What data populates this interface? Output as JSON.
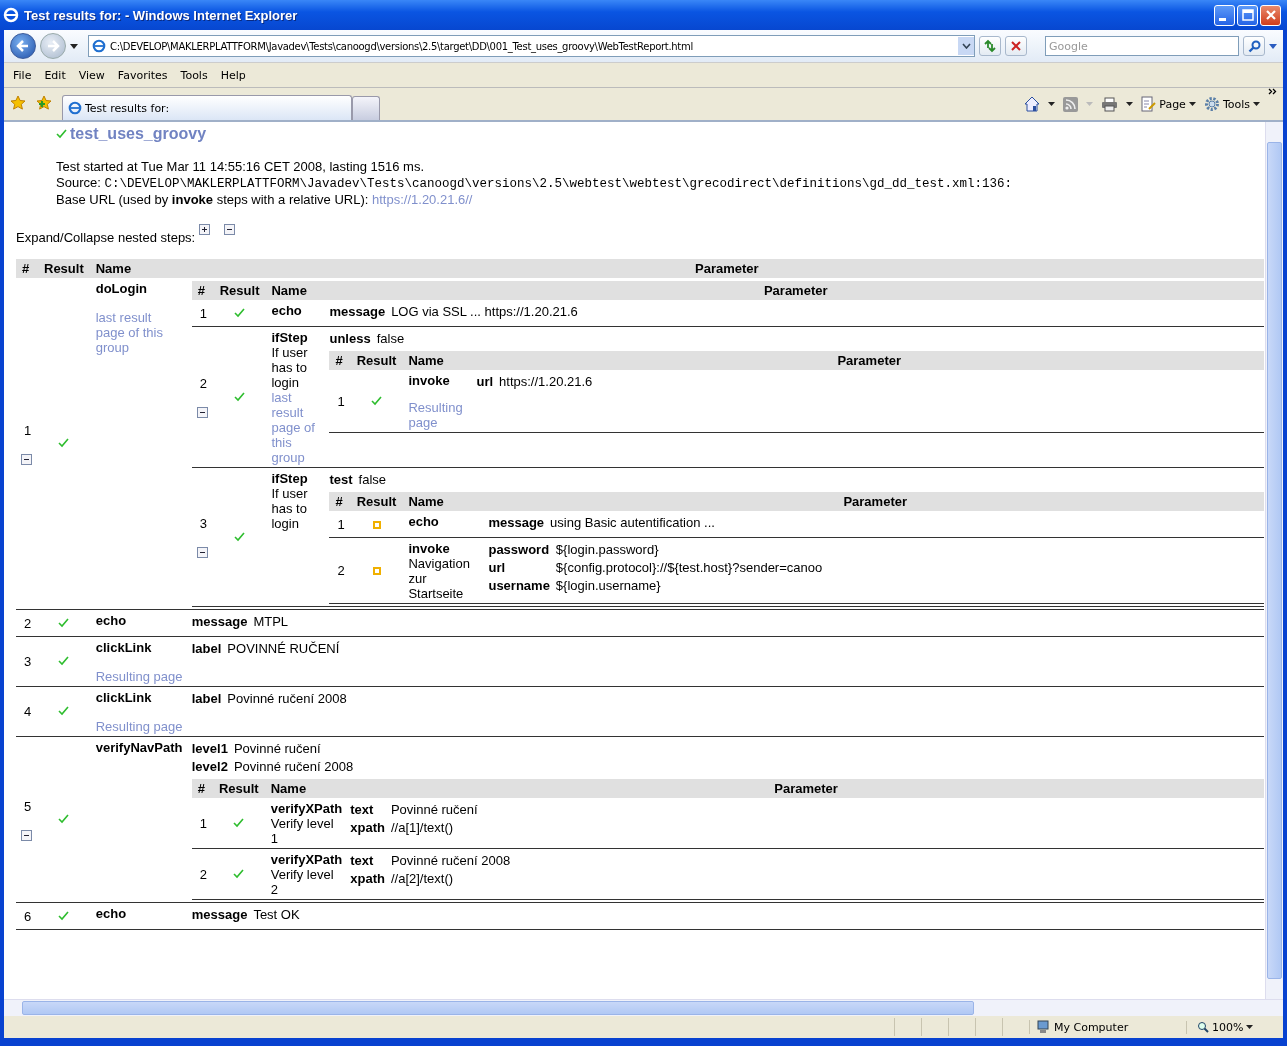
{
  "window": {
    "title": "Test results for: - Windows Internet Explorer"
  },
  "address_bar": {
    "value": "C:\\DEVELOP\\MAKLERPLATTFORM\\Javadev\\Tests\\canoogd\\versions\\2.5\\target\\DD\\001_Test_uses_groovy\\WebTestReport.html"
  },
  "search": {
    "placeholder": "Google"
  },
  "menu": [
    "File",
    "Edit",
    "View",
    "Favorites",
    "Tools",
    "Help"
  ],
  "tabs": [
    {
      "label": "Test results for:",
      "selected": true
    }
  ],
  "command_bar": [
    "Page",
    "Tools"
  ],
  "report": {
    "title": "test_uses_groovy",
    "passed": true,
    "started": "Test started at Tue Mar 11 14:55:16 CET 2008, lasting 1516 ms.",
    "source_label": "Source:",
    "source_path": "C:\\DEVELOP\\MAKLERPLATTFORM\\Javadev\\Tests\\canoogd\\versions\\2.5\\webtest\\webtest\\grecodirect\\definitions\\gd_dd_test.xml:136:",
    "base_url_label": "Base URL (used by **invoke** steps with a relative URL):",
    "base_url": "https://1.20.21.6//",
    "expand_label": "Expand/Collapse nested steps:",
    "table": {
      "columns": [
        "#",
        "Result",
        "Name",
        "Parameter"
      ],
      "steps": [
        {
          "number": "1",
          "passed": true,
          "name": "doLogin",
          "links": [
            "last result page of this group"
          ],
          "expanded": true,
          "table": {
            "columns": [
              "#",
              "Result",
              "Name",
              "Parameter"
            ],
            "steps": [
              {
                "number": "1",
                "passed": true,
                "name": "echo",
                "params": [
                  {
                    "key": "message",
                    "value": "LOG via SSL ... https://1.20.21.6"
                  }
                ]
              },
              {
                "number": "2",
                "passed": true,
                "name": "ifStep",
                "description": "If user has to login",
                "links": [
                  "last result page of this group"
                ],
                "expanded": true,
                "params": [
                  {
                    "key": "unless",
                    "value": "false"
                  }
                ],
                "table": {
                  "columns": [
                    "#",
                    "Result",
                    "Name",
                    "Parameter"
                  ],
                  "steps": [
                    {
                      "number": "1",
                      "passed": true,
                      "name": "invoke",
                      "links": [
                        "Resulting page"
                      ],
                      "params": [
                        {
                          "key": "url",
                          "value": "https://1.20.21.6"
                        }
                      ]
                    }
                  ]
                }
              },
              {
                "number": "3",
                "passed": true,
                "name": "ifStep",
                "description": "If user has to login",
                "expanded": true,
                "params": [
                  {
                    "key": "test",
                    "value": "false"
                  }
                ],
                "table": {
                  "columns": [
                    "#",
                    "Result",
                    "Name",
                    "Parameter"
                  ],
                  "steps": [
                    {
                      "number": "1",
                      "passed": false,
                      "name": "echo",
                      "params": [
                        {
                          "key": "message",
                          "value": "using Basic autentification ..."
                        }
                      ]
                    },
                    {
                      "number": "2",
                      "passed": false,
                      "name": "invoke",
                      "description": "Navigation zur Startseite",
                      "params": [
                        {
                          "key": "password",
                          "value": "${login.password}"
                        },
                        {
                          "key": "url",
                          "value": "${config.protocol}://${test.host}?sender=canoo"
                        },
                        {
                          "key": "username",
                          "value": "${login.username}"
                        }
                      ]
                    }
                  ]
                }
              }
            ]
          }
        },
        {
          "number": "2",
          "passed": true,
          "name": "echo",
          "params": [
            {
              "key": "message",
              "value": "MTPL"
            }
          ]
        },
        {
          "number": "3",
          "passed": true,
          "name": "clickLink",
          "links": [
            "Resulting page"
          ],
          "params": [
            {
              "key": "label",
              "value": "POVINNÉ RUČENÍ"
            }
          ]
        },
        {
          "number": "4",
          "passed": true,
          "name": "clickLink",
          "links": [
            "Resulting page"
          ],
          "params": [
            {
              "key": "label",
              "value": "Povinné ručení 2008"
            }
          ]
        },
        {
          "number": "5",
          "passed": true,
          "name": "verifyNavPath",
          "expanded": true,
          "params": [
            {
              "key": "level1",
              "value": "Povinné ručení"
            },
            {
              "key": "level2",
              "value": "Povinné ručení 2008"
            }
          ],
          "table": {
            "columns": [
              "#",
              "Result",
              "Name",
              "Parameter"
            ],
            "steps": [
              {
                "number": "1",
                "passed": true,
                "name": "verifyXPath",
                "description": "Verify level 1",
                "params": [
                  {
                    "key": "text",
                    "value": "Povinné ručení"
                  },
                  {
                    "key": "xpath",
                    "value": "//a[1]/text()"
                  }
                ]
              },
              {
                "number": "2",
                "passed": true,
                "name": "verifyXPath",
                "description": "Verify level 2",
                "params": [
                  {
                    "key": "text",
                    "value": "Povinné ručení 2008"
                  },
                  {
                    "key": "xpath",
                    "value": "//a[2]/text()"
                  }
                ]
              }
            ]
          }
        },
        {
          "number": "6",
          "passed": true,
          "name": "echo",
          "params": [
            {
              "key": "message",
              "value": "Test OK"
            }
          ]
        }
      ]
    }
  },
  "status_bar": {
    "zone": "My Computer",
    "zoom": "100%"
  }
}
